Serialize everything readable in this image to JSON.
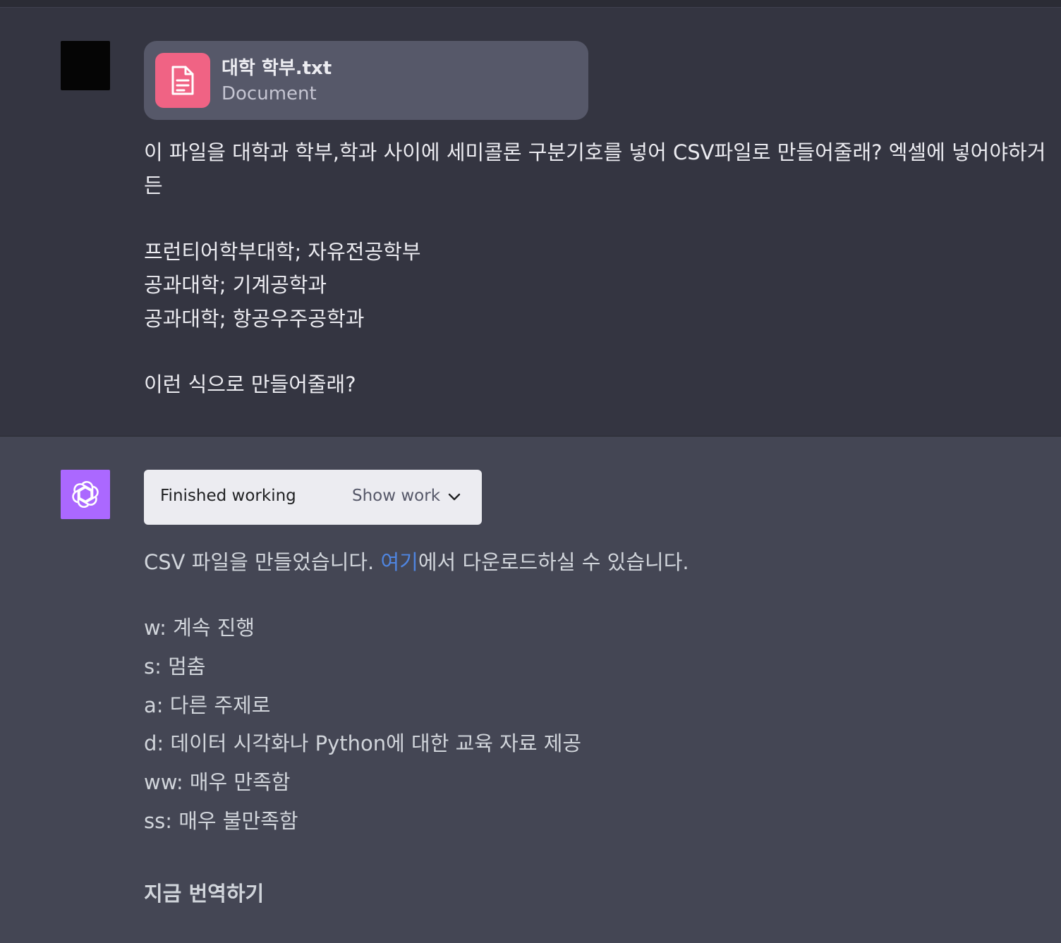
{
  "user_message": {
    "attachment": {
      "file_name": "대학 학부.txt",
      "file_type": "Document",
      "icon": "document-icon"
    },
    "lines": [
      "이 파일을 대학과 학부,학과 사이에 세미콜론 구분기호를 넣어 CSV파일로 만들어줄래? 엑셀에 넣어야하거",
      "든",
      "프런티어학부대학; 자유전공학부",
      "공과대학; 기계공학과",
      "공과대학; 항공우주공학과",
      "이런 식으로 만들어줄래?"
    ]
  },
  "assistant_message": {
    "tool": {
      "status": "Finished working",
      "toggle_label": "Show work"
    },
    "intro": {
      "before": "CSV 파일을 만들었습니다. ",
      "link": "여기",
      "after": "에서 다운로드하실 수 있습니다."
    },
    "options": [
      "w: 계속 진행",
      "s: 멈춤",
      "a: 다른 주제로",
      "d: 데이터 시각화나 Python에 대한 교육 자료 제공",
      "ww: 매우 만족함",
      "ss: 매우 불만족함"
    ],
    "translate_label": "지금 번역하기"
  },
  "colors": {
    "user_bg": "#343541",
    "assistant_bg": "#444654",
    "bot_avatar": "#ab68ff",
    "file_icon_bg": "#f06384",
    "link": "#4f85e0"
  }
}
